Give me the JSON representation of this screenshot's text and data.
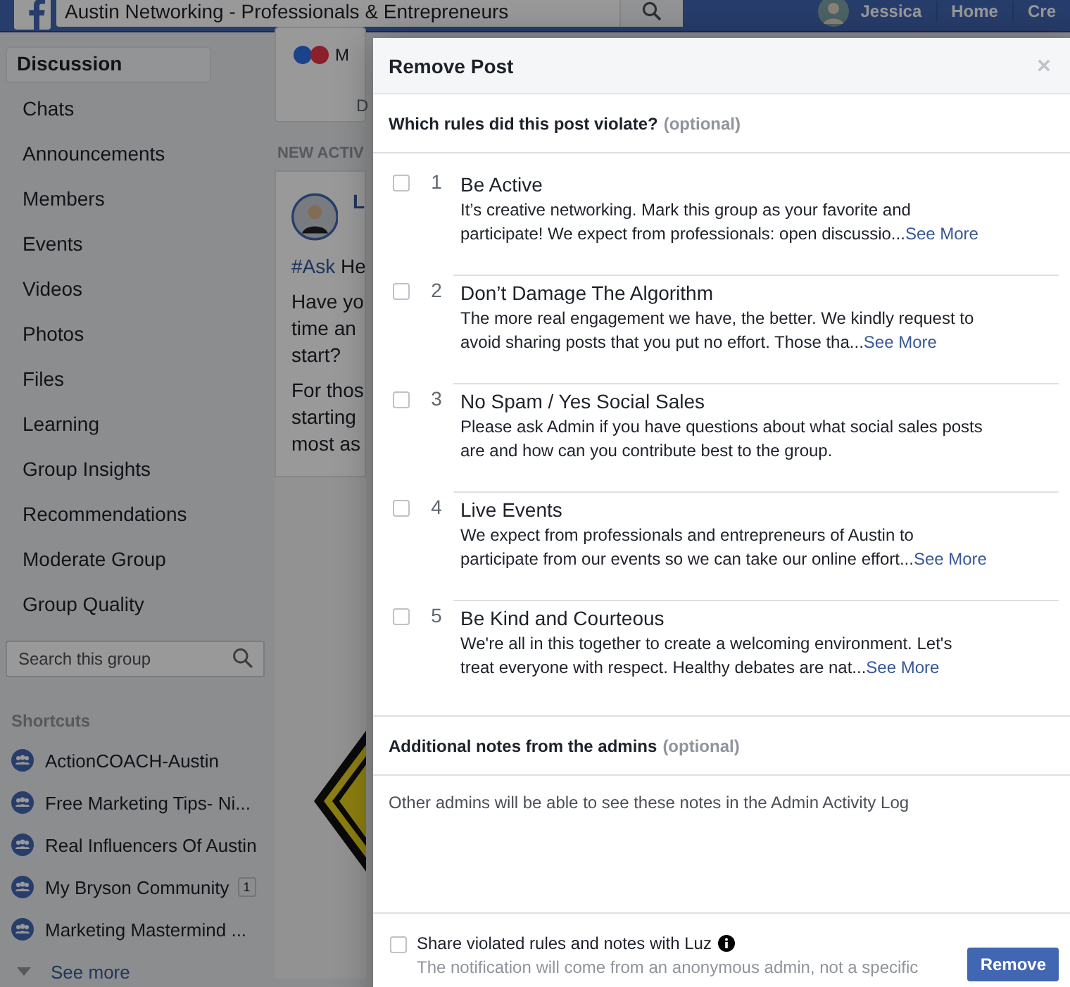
{
  "top_bar": {
    "search": {
      "value": "Austin Networking - Professionals & Entrepreneurs"
    },
    "user": "Jessica",
    "nav": [
      "Home",
      "Cre"
    ]
  },
  "sidebar": {
    "items": [
      {
        "label": "Discussion",
        "selected": true
      },
      {
        "label": "Chats",
        "selected": false
      },
      {
        "label": "Announcements",
        "selected": false
      },
      {
        "label": "Members",
        "selected": false
      },
      {
        "label": "Events",
        "selected": false
      },
      {
        "label": "Videos",
        "selected": false
      },
      {
        "label": "Photos",
        "selected": false
      },
      {
        "label": "Files",
        "selected": false
      },
      {
        "label": "Learning",
        "selected": false
      },
      {
        "label": "Group Insights",
        "selected": false
      },
      {
        "label": "Recommendations",
        "selected": false
      },
      {
        "label": "Moderate Group",
        "selected": false
      },
      {
        "label": "Group Quality",
        "selected": false
      }
    ],
    "search": {
      "placeholder": "Search this group"
    },
    "shortcuts_title": "Shortcuts",
    "shortcuts": [
      {
        "label": "ActionCOACH-Austin"
      },
      {
        "label": "Free Marketing Tips- Ni..."
      },
      {
        "label": "Real Influencers Of Austin"
      },
      {
        "label": "My Bryson Community",
        "badge": "1"
      },
      {
        "label": "Marketing Mastermind ..."
      }
    ],
    "see_more": "See more"
  },
  "feed": {
    "reaction_text": "M",
    "button_text": "D",
    "section_label": "NEW ACTIV",
    "post": {
      "author": "L",
      "tag": "#Ask",
      "tag_rest": "He",
      "lines": [
        "Have yo",
        "time an",
        "start?"
      ],
      "lines2": [
        "For thos",
        "starting",
        "most as"
      ]
    }
  },
  "dialog": {
    "title": "Remove Post",
    "rules_heading": "Which rules did this post violate?",
    "rules_optional": "(optional)",
    "rules": [
      {
        "number": "1",
        "title": "Be Active",
        "text": "It’s creative networking. Mark this group as your favorite and participate! We expect from professionals: open discussio...",
        "see_more": "See More",
        "checked": false
      },
      {
        "number": "2",
        "title": "Don’t Damage The Algorithm",
        "text": "The more real engagement we have, the better. We kindly request to avoid sharing posts that you put no effort. Those tha...",
        "see_more": "See More",
        "checked": false
      },
      {
        "number": "3",
        "title": "No Spam / Yes Social Sales",
        "text": "Please ask Admin if you have questions about what social sales posts are and how can you contribute best to the group.",
        "checked": false
      },
      {
        "number": "4",
        "title": "Live Events",
        "text": "We expect from professionals and entrepreneurs of Austin to participate from our events so we can take our online effort...",
        "see_more": "See More",
        "checked": false
      },
      {
        "number": "5",
        "title": "Be Kind and Courteous",
        "text": "We're all in this together to create a welcoming environment. Let's treat everyone with respect. Healthy debates are nat...",
        "see_more": "See More",
        "checked": false
      }
    ],
    "notes_heading": "Additional notes from the admins",
    "notes_optional": "(optional)",
    "notes_placeholder": "Other admins will be able to see these notes in the Admin Activity Log",
    "share": {
      "label": "Share violated rules and notes with Luz",
      "checked": false,
      "hint": "The notification will come from an anonymous admin, not a specific"
    },
    "remove_button": "Remove"
  }
}
